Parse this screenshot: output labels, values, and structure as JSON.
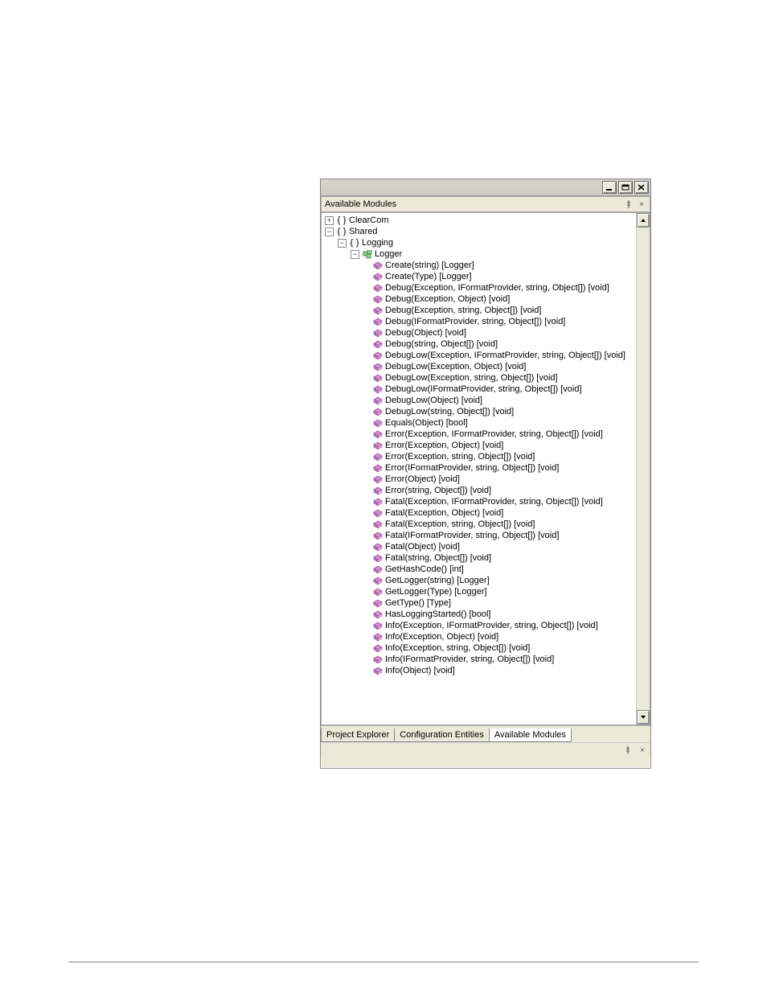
{
  "panel": {
    "title": "Available Modules"
  },
  "tabs": [
    {
      "id": "project-explorer",
      "label": "Project Explorer",
      "active": false
    },
    {
      "id": "configuration-entities",
      "label": "Configuration Entities",
      "active": false
    },
    {
      "id": "available-modules",
      "label": "Available Modules",
      "active": true
    }
  ],
  "tree": {
    "indentPx": 16,
    "nodes": [
      {
        "depth": 0,
        "expander": "plus",
        "icon": "namespace",
        "name": "node-clearcom",
        "label": "ClearCom",
        "interactable": true
      },
      {
        "depth": 0,
        "expander": "minus",
        "icon": "namespace",
        "name": "node-shared",
        "label": "Shared",
        "interactable": true
      },
      {
        "depth": 1,
        "expander": "minus",
        "icon": "namespace",
        "name": "node-logging",
        "label": "Logging",
        "interactable": true
      },
      {
        "depth": 2,
        "expander": "minus",
        "icon": "class",
        "name": "node-logger",
        "label": "Logger",
        "interactable": true
      },
      {
        "depth": 3,
        "expander": "none",
        "icon": "method",
        "name": "method-create-string",
        "label": "Create(string) [Logger]",
        "interactable": true
      },
      {
        "depth": 3,
        "expander": "none",
        "icon": "method",
        "name": "method-create-type",
        "label": "Create(Type) [Logger]",
        "interactable": true
      },
      {
        "depth": 3,
        "expander": "none",
        "icon": "method",
        "name": "method-debug-exc-fmt",
        "label": "Debug(Exception, IFormatProvider, string, Object[]) [void]",
        "interactable": true
      },
      {
        "depth": 3,
        "expander": "none",
        "icon": "method",
        "name": "method-debug-exc-obj",
        "label": "Debug(Exception, Object) [void]",
        "interactable": true
      },
      {
        "depth": 3,
        "expander": "none",
        "icon": "method",
        "name": "method-debug-exc-str",
        "label": "Debug(Exception, string, Object[]) [void]",
        "interactable": true
      },
      {
        "depth": 3,
        "expander": "none",
        "icon": "method",
        "name": "method-debug-fmt",
        "label": "Debug(IFormatProvider, string, Object[]) [void]",
        "interactable": true
      },
      {
        "depth": 3,
        "expander": "none",
        "icon": "method",
        "name": "method-debug-obj",
        "label": "Debug(Object) [void]",
        "interactable": true
      },
      {
        "depth": 3,
        "expander": "none",
        "icon": "method",
        "name": "method-debug-str",
        "label": "Debug(string, Object[]) [void]",
        "interactable": true
      },
      {
        "depth": 3,
        "expander": "none",
        "icon": "method",
        "name": "method-debuglow-exc-fmt",
        "label": "DebugLow(Exception, IFormatProvider, string, Object[]) [void]",
        "interactable": true
      },
      {
        "depth": 3,
        "expander": "none",
        "icon": "method",
        "name": "method-debuglow-exc-obj",
        "label": "DebugLow(Exception, Object) [void]",
        "interactable": true
      },
      {
        "depth": 3,
        "expander": "none",
        "icon": "method",
        "name": "method-debuglow-exc-str",
        "label": "DebugLow(Exception, string, Object[]) [void]",
        "interactable": true
      },
      {
        "depth": 3,
        "expander": "none",
        "icon": "method",
        "name": "method-debuglow-fmt",
        "label": "DebugLow(IFormatProvider, string, Object[]) [void]",
        "interactable": true
      },
      {
        "depth": 3,
        "expander": "none",
        "icon": "method",
        "name": "method-debuglow-obj",
        "label": "DebugLow(Object) [void]",
        "interactable": true
      },
      {
        "depth": 3,
        "expander": "none",
        "icon": "method",
        "name": "method-debuglow-str",
        "label": "DebugLow(string, Object[]) [void]",
        "interactable": true
      },
      {
        "depth": 3,
        "expander": "none",
        "icon": "method",
        "name": "method-equals",
        "label": "Equals(Object) [bool]",
        "interactable": true
      },
      {
        "depth": 3,
        "expander": "none",
        "icon": "method",
        "name": "method-error-exc-fmt",
        "label": "Error(Exception, IFormatProvider, string, Object[]) [void]",
        "interactable": true
      },
      {
        "depth": 3,
        "expander": "none",
        "icon": "method",
        "name": "method-error-exc-obj",
        "label": "Error(Exception, Object) [void]",
        "interactable": true
      },
      {
        "depth": 3,
        "expander": "none",
        "icon": "method",
        "name": "method-error-exc-str",
        "label": "Error(Exception, string, Object[]) [void]",
        "interactable": true
      },
      {
        "depth": 3,
        "expander": "none",
        "icon": "method",
        "name": "method-error-fmt",
        "label": "Error(IFormatProvider, string, Object[]) [void]",
        "interactable": true
      },
      {
        "depth": 3,
        "expander": "none",
        "icon": "method",
        "name": "method-error-obj",
        "label": "Error(Object) [void]",
        "interactable": true
      },
      {
        "depth": 3,
        "expander": "none",
        "icon": "method",
        "name": "method-error-str",
        "label": "Error(string, Object[]) [void]",
        "interactable": true
      },
      {
        "depth": 3,
        "expander": "none",
        "icon": "method",
        "name": "method-fatal-exc-fmt",
        "label": "Fatal(Exception, IFormatProvider, string, Object[]) [void]",
        "interactable": true
      },
      {
        "depth": 3,
        "expander": "none",
        "icon": "method",
        "name": "method-fatal-exc-obj",
        "label": "Fatal(Exception, Object) [void]",
        "interactable": true
      },
      {
        "depth": 3,
        "expander": "none",
        "icon": "method",
        "name": "method-fatal-exc-str",
        "label": "Fatal(Exception, string, Object[]) [void]",
        "interactable": true
      },
      {
        "depth": 3,
        "expander": "none",
        "icon": "method",
        "name": "method-fatal-fmt",
        "label": "Fatal(IFormatProvider, string, Object[]) [void]",
        "interactable": true
      },
      {
        "depth": 3,
        "expander": "none",
        "icon": "method",
        "name": "method-fatal-obj",
        "label": "Fatal(Object) [void]",
        "interactable": true
      },
      {
        "depth": 3,
        "expander": "none",
        "icon": "method",
        "name": "method-fatal-str",
        "label": "Fatal(string, Object[]) [void]",
        "interactable": true
      },
      {
        "depth": 3,
        "expander": "none",
        "icon": "method",
        "name": "method-gethashcode",
        "label": "GetHashCode() [int]",
        "interactable": true
      },
      {
        "depth": 3,
        "expander": "none",
        "icon": "method",
        "name": "method-getlogger-string",
        "label": "GetLogger(string) [Logger]",
        "interactable": true
      },
      {
        "depth": 3,
        "expander": "none",
        "icon": "method",
        "name": "method-getlogger-type",
        "label": "GetLogger(Type) [Logger]",
        "interactable": true
      },
      {
        "depth": 3,
        "expander": "none",
        "icon": "method",
        "name": "method-gettype",
        "label": "GetType() [Type]",
        "interactable": true
      },
      {
        "depth": 3,
        "expander": "none",
        "icon": "method",
        "name": "method-hasloggingstarted",
        "label": "HasLoggingStarted() [bool]",
        "interactable": true
      },
      {
        "depth": 3,
        "expander": "none",
        "icon": "method",
        "name": "method-info-exc-fmt",
        "label": "Info(Exception, IFormatProvider, string, Object[]) [void]",
        "interactable": true
      },
      {
        "depth": 3,
        "expander": "none",
        "icon": "method",
        "name": "method-info-exc-obj",
        "label": "Info(Exception, Object) [void]",
        "interactable": true
      },
      {
        "depth": 3,
        "expander": "none",
        "icon": "method",
        "name": "method-info-exc-str",
        "label": "Info(Exception, string, Object[]) [void]",
        "interactable": true
      },
      {
        "depth": 3,
        "expander": "none",
        "icon": "method",
        "name": "method-info-fmt",
        "label": "Info(IFormatProvider, string, Object[]) [void]",
        "interactable": true
      },
      {
        "depth": 3,
        "expander": "none",
        "icon": "method",
        "name": "method-info-obj",
        "label": "Info(Object) [void]",
        "interactable": true
      }
    ]
  }
}
